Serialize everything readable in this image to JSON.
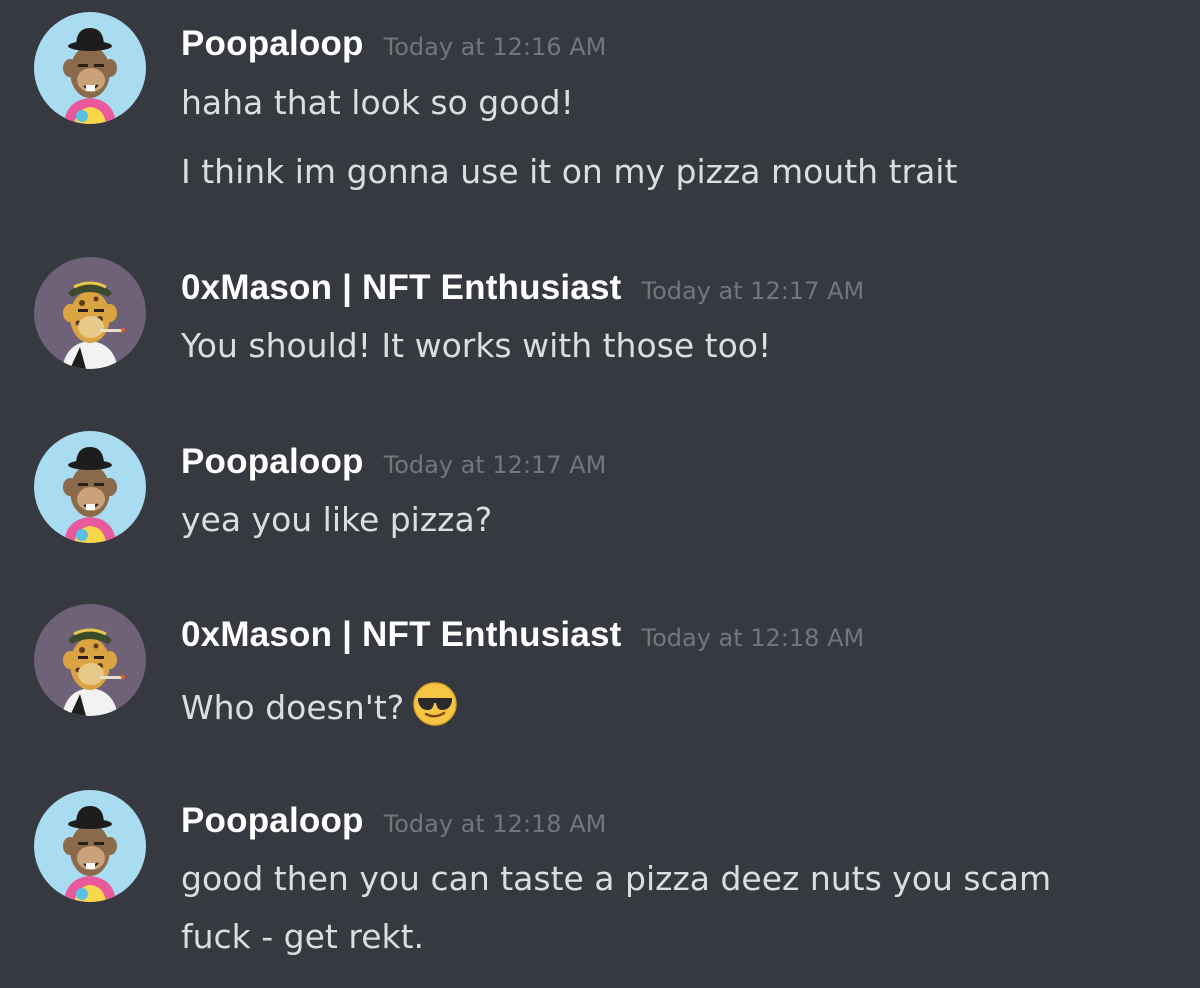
{
  "messages": [
    {
      "author": "Poopaloop",
      "timestamp": "Today at 12:16 AM",
      "avatar": "bored-ape-blue-avatar",
      "lines": [
        "haha that look so good!",
        "I think im gonna use it on my pizza mouth trait"
      ]
    },
    {
      "author": "0xMason | NFT Enthusiast",
      "timestamp": "Today at 12:17 AM",
      "avatar": "bored-ape-purple-avatar",
      "lines": [
        "You should! It works with those too!"
      ]
    },
    {
      "author": "Poopaloop",
      "timestamp": "Today at 12:17 AM",
      "avatar": "bored-ape-blue-avatar",
      "lines": [
        "yea you like pizza?"
      ]
    },
    {
      "author": "0xMason | NFT Enthusiast",
      "timestamp": "Today at 12:18 AM",
      "avatar": "bored-ape-purple-avatar",
      "lines": [
        "Who doesn't?"
      ],
      "emoji": "sunglasses-emoji"
    },
    {
      "author": "Poopaloop",
      "timestamp": "Today at 12:18 AM",
      "avatar": "bored-ape-blue-avatar",
      "lines": [
        "good then you can taste a pizza deez nuts you scam",
        "fuck - get rekt."
      ]
    }
  ],
  "colors": {
    "background": "#36393f",
    "author": "#ffffff",
    "timestamp": "#72767d",
    "text": "#dcddde",
    "avatar_blue_bg": "#a9dcf0",
    "avatar_purple_bg": "#6e6178"
  }
}
